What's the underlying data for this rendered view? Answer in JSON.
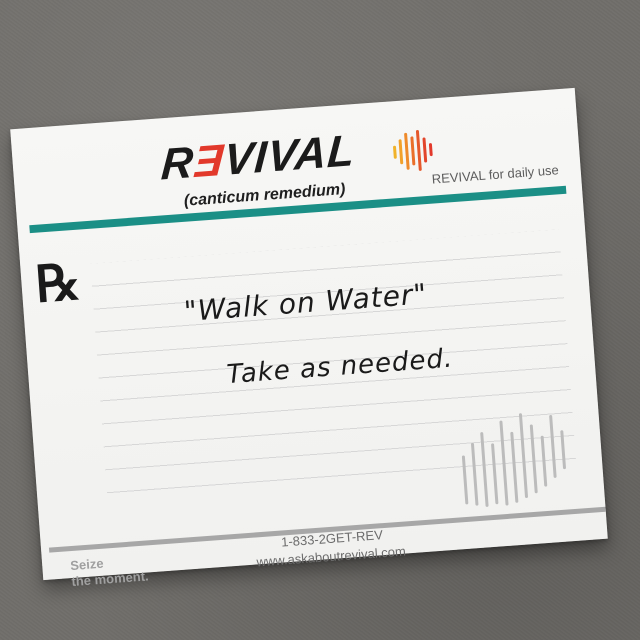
{
  "brand": {
    "logo_text_prefix": "R",
    "logo_text_e": "Ǝ",
    "logo_text_suffix": "VIVAL",
    "tagline": "(canticum remedium)",
    "daily_use": "REVIVAL for daily use",
    "accent_color": "#e2392b",
    "teal_color": "#1b8f86"
  },
  "prescription": {
    "symbol": "℞",
    "line1": "\"Walk on Water\"",
    "line2": "Take as needed."
  },
  "footer": {
    "slogan_line1": "Seize",
    "slogan_line2": "the moment.",
    "phone": "1-833-2GET-REV",
    "website": "www.askaboutrevival.com"
  },
  "icons": [
    "sound-wave-logo-icon",
    "sound-wave-watermark-icon"
  ]
}
